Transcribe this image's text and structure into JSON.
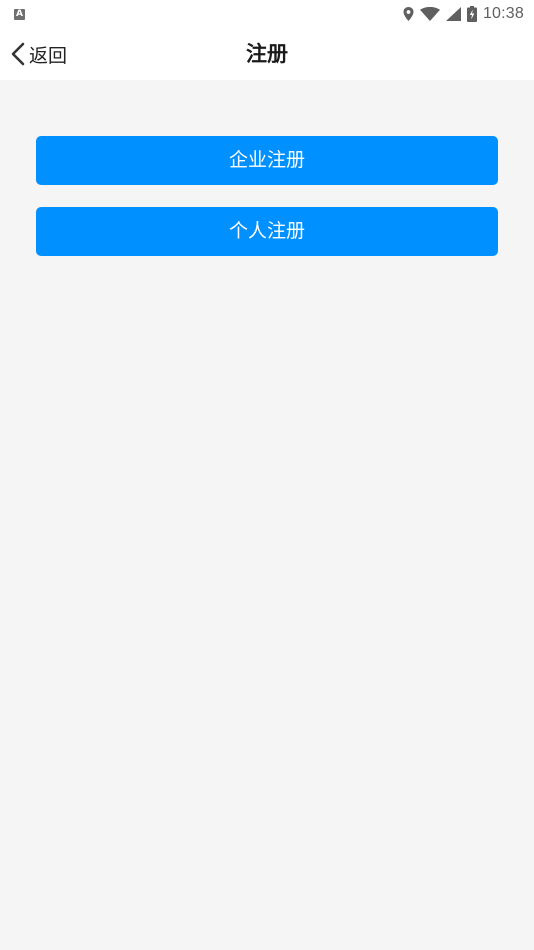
{
  "status_bar": {
    "notification_badge": "A",
    "time": "10:38",
    "icons": [
      "location-icon",
      "wifi-icon",
      "signal-icon",
      "battery-charging-icon"
    ]
  },
  "header": {
    "back_label": "返回",
    "title": "注册"
  },
  "actions": {
    "enterprise_label": "企业注册",
    "personal_label": "个人注册"
  },
  "colors": {
    "accent": "#0090ff",
    "background": "#f5f5f5",
    "bar_background": "#ffffff"
  }
}
